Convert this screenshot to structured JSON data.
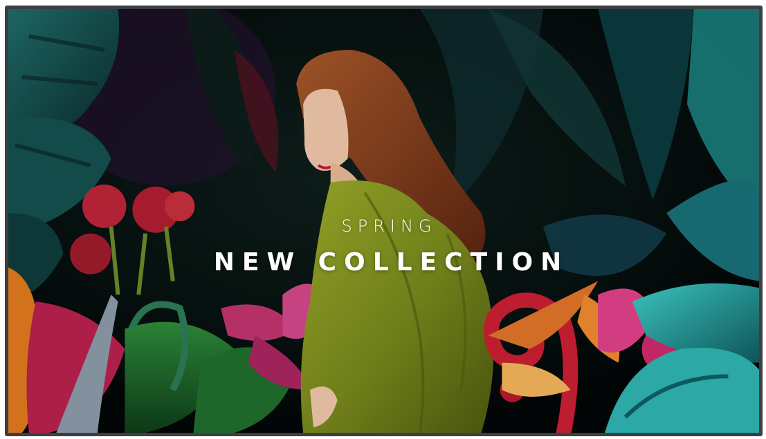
{
  "hero": {
    "eyebrow": "SPRING",
    "title": "NEW COLLECTION",
    "image_subject": "model in olive-green suit among tropical flowers and leaves"
  },
  "colors": {
    "frame_border": "#3d3f42",
    "background": "#060a0d",
    "text": "#ffffff",
    "suit": "#7a8a1f",
    "hair": "#8a3f1c",
    "teal_leaf": "#2fb3b1",
    "red_flower": "#c8263c",
    "magenta_flower": "#c2346f",
    "orange_leaf": "#e07a1e"
  }
}
